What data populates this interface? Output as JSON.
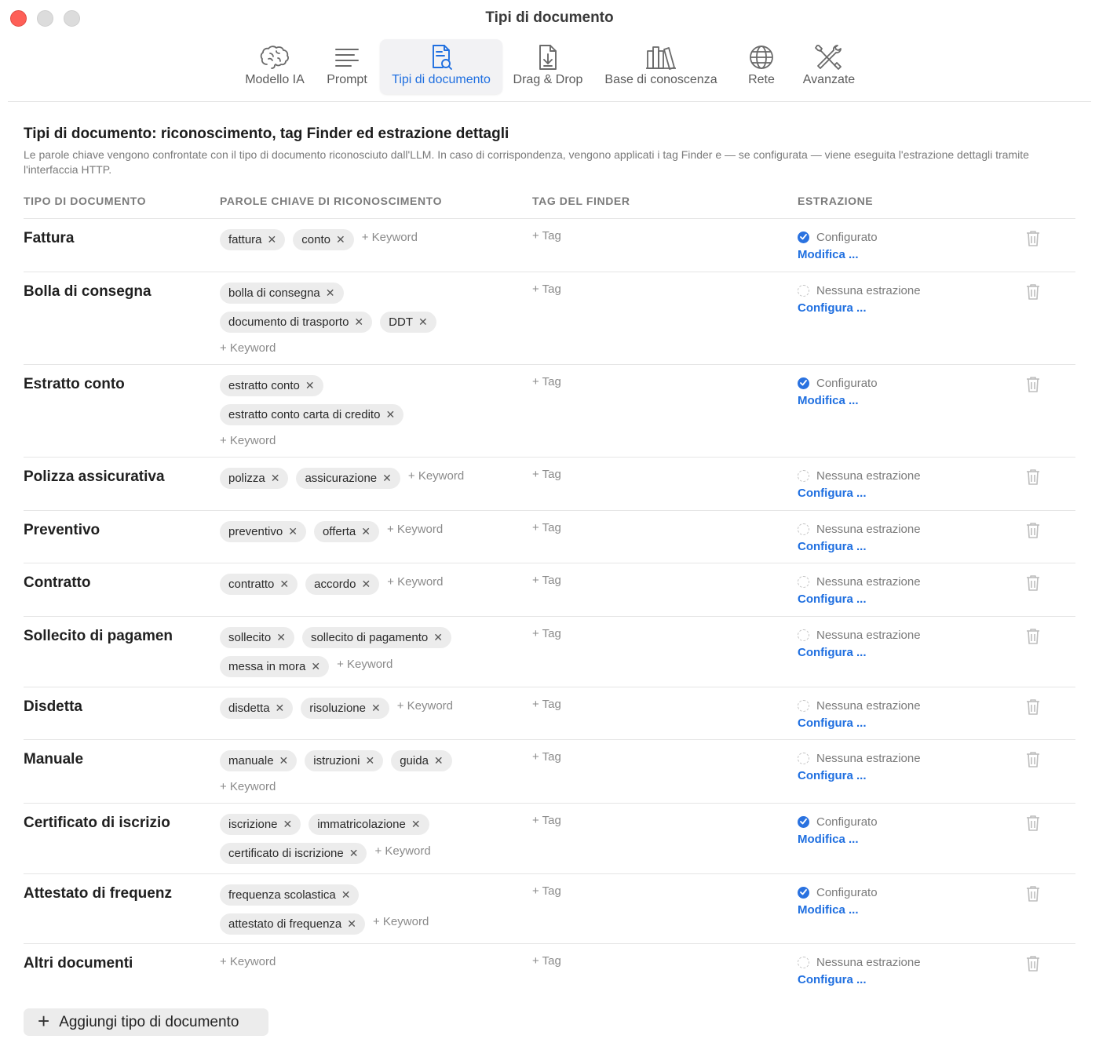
{
  "window": {
    "title": "Tipi di documento"
  },
  "toolbar": {
    "tabs": [
      {
        "label": "Modello IA",
        "icon": "brain-icon"
      },
      {
        "label": "Prompt",
        "icon": "text-lines-icon"
      },
      {
        "label": "Tipi di documento",
        "icon": "document-search-icon",
        "active": true
      },
      {
        "label": "Drag & Drop",
        "icon": "document-download-icon"
      },
      {
        "label": "Base di conoscenza",
        "icon": "books-icon"
      },
      {
        "label": "Rete",
        "icon": "globe-icon"
      },
      {
        "label": "Avanzate",
        "icon": "tools-icon"
      }
    ]
  },
  "header": {
    "title": "Tipi di documento: riconoscimento, tag Finder ed estrazione dettagli",
    "description": "Le parole chiave vengono confrontate con il tipo di documento riconosciuto dall'LLM. In caso di corrispondenza, vengono applicati i tag Finder e — se configurata — viene eseguita l'estrazione dettagli tramite l'interfaccia HTTP."
  },
  "columns": {
    "type": "TIPO DI DOCUMENTO",
    "keywords": "PAROLE CHIAVE DI RICONOSCIMENTO",
    "tags": "TAG DEL FINDER",
    "extraction": "ESTRAZIONE"
  },
  "labels": {
    "add_keyword": "+ Keyword",
    "add_tag": "+ Tag",
    "chip_remove": "✕",
    "configured": "Configurato",
    "not_configured": "Nessuna estrazione",
    "edit": "Modifica ...",
    "configure": "Configura ...",
    "add_type": "Aggiungi tipo di documento",
    "add_type_plus": "+"
  },
  "rows": [
    {
      "name": "Fattura",
      "keyword_lines": [
        [
          "fattura",
          "conto"
        ]
      ],
      "add_inline": true,
      "configured": true
    },
    {
      "name": "Bolla di consegna",
      "keyword_lines": [
        [
          "bolla di consegna"
        ],
        [
          "documento di trasporto",
          "DDT"
        ]
      ],
      "add_inline": false,
      "configured": false
    },
    {
      "name": "Estratto conto",
      "keyword_lines": [
        [
          "estratto conto"
        ],
        [
          "estratto conto carta di credito"
        ]
      ],
      "add_inline": false,
      "configured": true
    },
    {
      "name": "Polizza assicurativa",
      "keyword_lines": [
        [
          "polizza",
          "assicurazione"
        ]
      ],
      "add_inline": true,
      "configured": false
    },
    {
      "name": "Preventivo",
      "keyword_lines": [
        [
          "preventivo",
          "offerta"
        ]
      ],
      "add_inline": true,
      "configured": false
    },
    {
      "name": "Contratto",
      "keyword_lines": [
        [
          "contratto",
          "accordo"
        ]
      ],
      "add_inline": true,
      "configured": false
    },
    {
      "name": "Sollecito di pagamen",
      "keyword_lines": [
        [
          "sollecito",
          "sollecito di pagamento"
        ],
        [
          "messa in mora"
        ]
      ],
      "add_inline": true,
      "configured": false
    },
    {
      "name": "Disdetta",
      "keyword_lines": [
        [
          "disdetta",
          "risoluzione"
        ]
      ],
      "add_inline": true,
      "configured": false
    },
    {
      "name": "Manuale",
      "keyword_lines": [
        [
          "manuale",
          "istruzioni",
          "guida"
        ]
      ],
      "add_inline": false,
      "configured": false
    },
    {
      "name": "Certificato di iscrizio",
      "keyword_lines": [
        [
          "iscrizione",
          "immatricolazione"
        ],
        [
          "certificato di iscrizione"
        ]
      ],
      "add_inline": true,
      "configured": true
    },
    {
      "name": "Attestato di frequenz",
      "keyword_lines": [
        [
          "frequenza scolastica"
        ],
        [
          "attestato di frequenza"
        ]
      ],
      "add_inline": true,
      "configured": true
    },
    {
      "name": "Altri documenti",
      "keyword_lines": [],
      "add_inline": false,
      "configured": false
    }
  ],
  "colors": {
    "accent": "#1f6fe0",
    "close": "#fe5f57"
  }
}
